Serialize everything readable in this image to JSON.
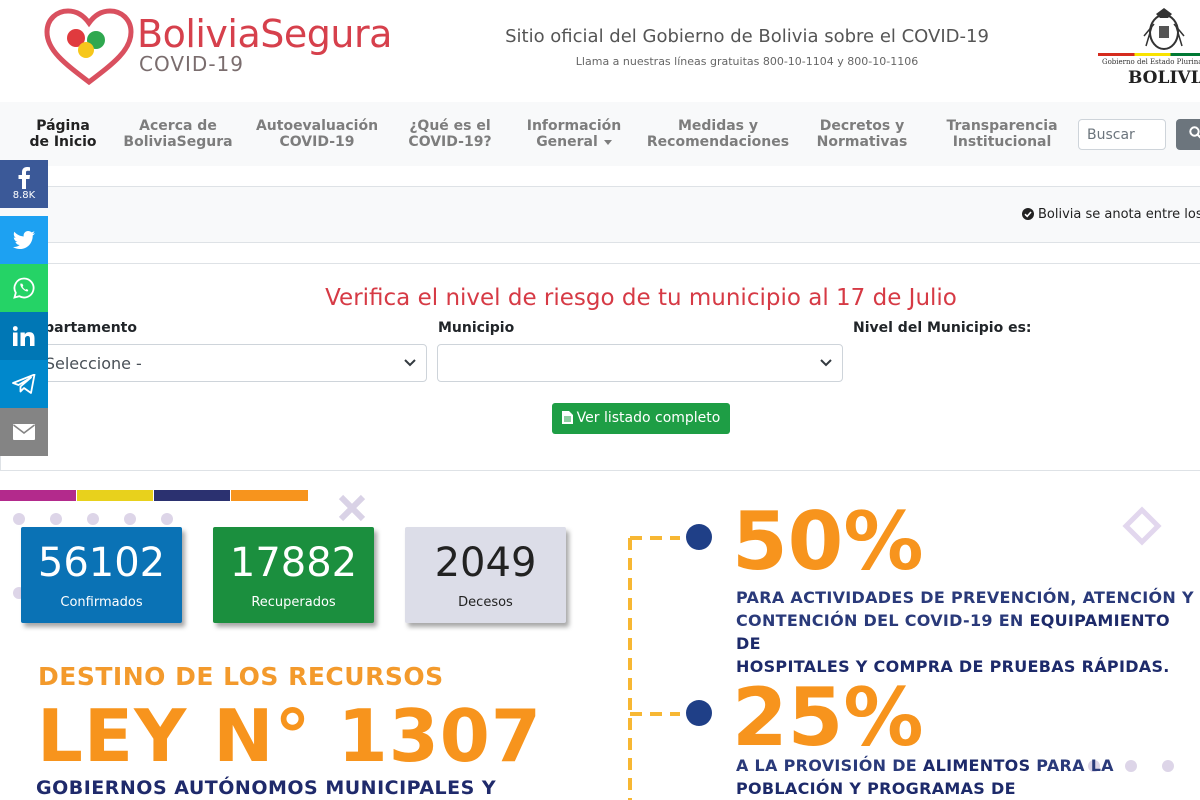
{
  "brand": {
    "title": "BoliviaSegura",
    "subtitle": "COVID-19"
  },
  "header": {
    "title": "Sitio oficial del Gobierno de Bolivia sobre el COVID-19",
    "subtitle": "Llama a nuestras líneas gratuitas 800-10-1104 y 800-10-1106"
  },
  "gov_logo": {
    "small": "Gobierno del Estado Plurinacional de",
    "big": "BOLIVIA"
  },
  "nav": {
    "items": [
      {
        "line1": "Página",
        "line2": "de Inicio"
      },
      {
        "line1": "Acerca de",
        "line2": "BoliviaSegura"
      },
      {
        "line1": "Autoevaluación",
        "line2": "COVID-19"
      },
      {
        "line1": "¿Qué es el",
        "line2": "COVID-19?"
      },
      {
        "line1": "Información",
        "line2": "General"
      },
      {
        "line1": "Medidas y",
        "line2": "Recomendaciones"
      },
      {
        "line1": "Decretos y",
        "line2": "Normativas"
      },
      {
        "line1": "Transparencia",
        "line2": "Institucional"
      }
    ],
    "search_placeholder": "Buscar"
  },
  "ticker": {
    "text": "Bolivia se anota entre los"
  },
  "social": {
    "facebook_count": "8.8K"
  },
  "risk": {
    "title": "Verifica el nivel de riesgo de tu municipio al 17 de Julio",
    "departamento_label": "Departamento",
    "departamento_value": "- Seleccione -",
    "municipio_label": "Municipio",
    "municipio_value": "",
    "nivel_label": "Nivel del Municipio es:",
    "button_label": "Ver listado completo"
  },
  "stats": [
    {
      "value": "56102",
      "label": "Confirmados"
    },
    {
      "value": "17882",
      "label": "Recuperados"
    },
    {
      "value": "2049",
      "label": "Decesos"
    }
  ],
  "banner": {
    "heading": "DESTINO DE LOS RECURSOS",
    "law": "LEY N° 1307",
    "gob": "GOBIERNOS AUTÓNOMOS MUNICIPALES Y",
    "pct1": "50%",
    "pct1_l1": "PARA ACTIVIDADES DE PREVENCIÓN, ATENCIÓN Y",
    "pct1_l2a": "CONTENCIÓN DEL COVID-19 EN ",
    "pct1_l2b": "EQUIPAMIENTO DE",
    "pct1_l3": "HOSPITALES Y COMPRA DE PRUEBAS RÁPIDAS.",
    "pct2": "25%",
    "pct2_l1a": "A LA PROVISIÓN DE ",
    "pct2_l1b": "ALIMENTOS",
    "pct2_l1c": " PARA LA",
    "pct2_l2": "POBLACIÓN Y PROGRAMAS DE"
  },
  "colors": {
    "brand_red": "#d6404c",
    "confirmed": "#0a72b5",
    "recovered": "#1b8f3e",
    "deaths": "#dcdde8",
    "accent_orange": "#f7941d",
    "facebook": "#3b5998",
    "twitter": "#1da1f2",
    "whatsapp": "#25d366",
    "linkedin": "#0077b5",
    "telegram": "#0088cc",
    "email": "#848484"
  }
}
